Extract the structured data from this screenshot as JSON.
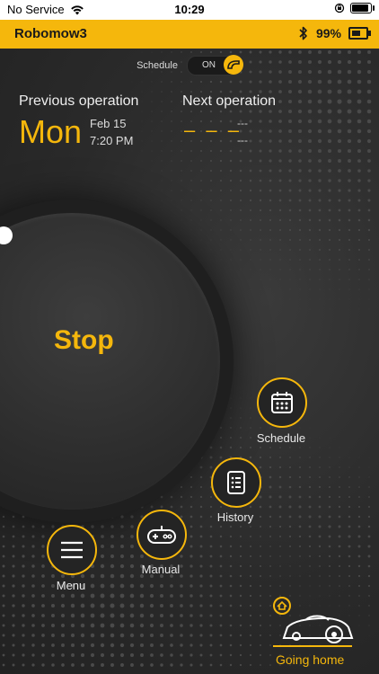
{
  "statusbar": {
    "carrier": "No Service",
    "time": "10:29",
    "battery_fill": 0.95
  },
  "appbar": {
    "title": "Robomow3",
    "battery_percent": "99%",
    "robot_battery_fill": 0.9
  },
  "schedule_toggle": {
    "label": "Schedule",
    "state": "ON"
  },
  "operations": {
    "previous_label": "Previous operation",
    "previous_day": "Mon",
    "previous_date": "Feb 15",
    "previous_time": "7:20 PM",
    "next_label": "Next operation",
    "next_day": "– – –",
    "next_date": "---",
    "next_time": "---"
  },
  "stop_button": {
    "label": "Stop"
  },
  "nav": {
    "schedule": "Schedule",
    "history": "History",
    "manual": "Manual",
    "menu": "Menu"
  },
  "going_home": {
    "label": "Going home"
  },
  "colors": {
    "accent": "#f5b70c",
    "background": "#2b2b2b"
  }
}
